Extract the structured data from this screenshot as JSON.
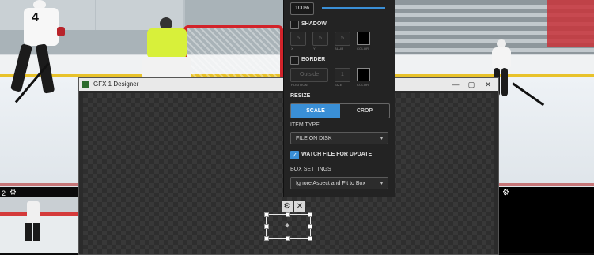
{
  "scene": {
    "left_player_number": "4"
  },
  "thumbnails": {
    "left_label": "2"
  },
  "designer": {
    "title": "GFX 1 Designer",
    "btn_minimize": "—",
    "btn_restore": "▢",
    "btn_close": "✕"
  },
  "panel": {
    "opacity_value": "100%",
    "shadow": {
      "label": "SHADOW",
      "x": "5",
      "y": "5",
      "blur": "5",
      "sub_x": "X",
      "sub_y": "Y",
      "sub_blur": "BLUR",
      "sub_color": "COLOR",
      "enabled": false
    },
    "border": {
      "label": "BORDER",
      "position_value": "Outside",
      "size_value": "1",
      "sub_position": "POSITION",
      "sub_size": "SIZE",
      "sub_color": "COLOR",
      "enabled": false
    },
    "resize": {
      "label": "RESIZE",
      "scale": "SCALE",
      "crop": "CROP",
      "selected": "SCALE"
    },
    "item_type": {
      "label": "ITEM TYPE",
      "value": "FILE ON DISK"
    },
    "watch_file": {
      "label": "WATCH FILE FOR UPDATE",
      "checked": true
    },
    "box_settings": {
      "label": "BOX SETTINGS",
      "value": "Ignore Aspect and Fit to Box"
    }
  },
  "selection": {
    "gear_glyph": "⚙",
    "close_glyph": "✕",
    "center_glyph": "✦"
  },
  "icons": {
    "gear": "⚙",
    "check": "✓",
    "caret": "▾"
  },
  "colors": {
    "accent": "#3a8fd6",
    "panel_bg": "#232323",
    "goalie_jersey": "#d8f03a",
    "rink_red": "#d2232a"
  }
}
